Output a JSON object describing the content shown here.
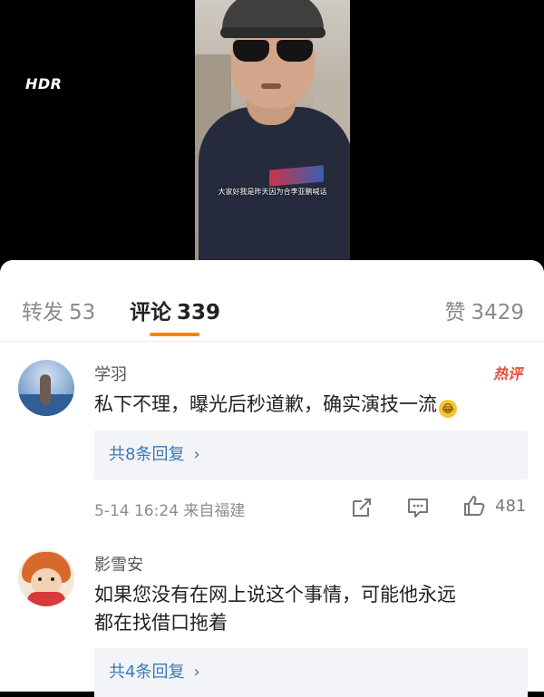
{
  "video": {
    "hdr_label": "HDR",
    "subtitle": "大家好我是昨天因为合李亚鹏喊话"
  },
  "tabs": {
    "forward": {
      "label": "转发",
      "count": "53"
    },
    "comment": {
      "label": "评论",
      "count": "339"
    },
    "like": {
      "label": "赞",
      "count": "3429"
    }
  },
  "comments": [
    {
      "username": "学羽",
      "badge": "热评",
      "text": "私下不理，曝光后秒道歉，确实演技一流",
      "emoji": "😂",
      "reply_label": "共8条回复",
      "time_location": "5-14 16:24 来自福建",
      "like_count": "481"
    },
    {
      "username": "影雪安",
      "text_line1": "如果您没有在网上说这个事情，可能他永远",
      "text_line2": "都在找借口拖着",
      "reply_label": "共4条回复"
    }
  ],
  "icons": {
    "share": "share-icon",
    "comment": "comment-icon",
    "like": "thumbs-up-icon",
    "chevron": "chevron-right-icon"
  },
  "colors": {
    "accent": "#ff8200",
    "link": "#3a7ab3",
    "hot": "#e84b3a"
  }
}
